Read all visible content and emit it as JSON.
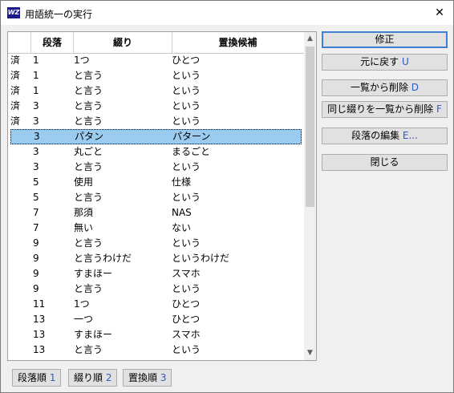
{
  "window": {
    "title": "用語統一の実行",
    "icon_label": "WZ",
    "close_glyph": "✕"
  },
  "list": {
    "headers": {
      "mark": "",
      "paragraph": "段落",
      "spelling": "綴り",
      "replacement": "置換候補"
    },
    "rows": [
      {
        "mark": "済",
        "para": "1",
        "spelling": "1つ",
        "replacement": "ひとつ",
        "selected": false
      },
      {
        "mark": "済",
        "para": "1",
        "spelling": "と言う",
        "replacement": "という",
        "selected": false
      },
      {
        "mark": "済",
        "para": "1",
        "spelling": "と言う",
        "replacement": "という",
        "selected": false
      },
      {
        "mark": "済",
        "para": "3",
        "spelling": "と言う",
        "replacement": "という",
        "selected": false
      },
      {
        "mark": "済",
        "para": "3",
        "spelling": "と言う",
        "replacement": "という",
        "selected": false
      },
      {
        "mark": "",
        "para": "3",
        "spelling": "パタン",
        "replacement": "パターン",
        "selected": true
      },
      {
        "mark": "",
        "para": "3",
        "spelling": "丸ごと",
        "replacement": "まるごと",
        "selected": false
      },
      {
        "mark": "",
        "para": "3",
        "spelling": "と言う",
        "replacement": "という",
        "selected": false
      },
      {
        "mark": "",
        "para": "5",
        "spelling": "使用",
        "replacement": "仕様",
        "selected": false
      },
      {
        "mark": "",
        "para": "5",
        "spelling": "と言う",
        "replacement": "という",
        "selected": false
      },
      {
        "mark": "",
        "para": "7",
        "spelling": "那須",
        "replacement": "NAS",
        "selected": false
      },
      {
        "mark": "",
        "para": "7",
        "spelling": "無い",
        "replacement": "ない",
        "selected": false
      },
      {
        "mark": "",
        "para": "9",
        "spelling": "と言う",
        "replacement": "という",
        "selected": false
      },
      {
        "mark": "",
        "para": "9",
        "spelling": "と言うわけだ",
        "replacement": "というわけだ",
        "selected": false
      },
      {
        "mark": "",
        "para": "9",
        "spelling": "すまほー",
        "replacement": "スマホ",
        "selected": false
      },
      {
        "mark": "",
        "para": "9",
        "spelling": "と言う",
        "replacement": "という",
        "selected": false
      },
      {
        "mark": "",
        "para": "11",
        "spelling": "1つ",
        "replacement": "ひとつ",
        "selected": false
      },
      {
        "mark": "",
        "para": "13",
        "spelling": "一つ",
        "replacement": "ひとつ",
        "selected": false
      },
      {
        "mark": "",
        "para": "13",
        "spelling": "すまほー",
        "replacement": "スマホ",
        "selected": false
      },
      {
        "mark": "",
        "para": "13",
        "spelling": "と言う",
        "replacement": "という",
        "selected": false
      }
    ]
  },
  "buttons": {
    "fix": {
      "label": "修正",
      "key": ""
    },
    "undo": {
      "label": "元に戻す",
      "key": "U"
    },
    "delete": {
      "label": "一覧から削除",
      "key": "D"
    },
    "delete_same": {
      "label": "同じ綴りを一覧から削除",
      "key": "F"
    },
    "edit_paragraph": {
      "label": "段落の編集",
      "key": "E..."
    },
    "close": {
      "label": "閉じる",
      "key": ""
    }
  },
  "sort_tabs": [
    {
      "label": "段落順",
      "key": "1"
    },
    {
      "label": "綴り順",
      "key": "2"
    },
    {
      "label": "置換順",
      "key": "3"
    }
  ],
  "scrollbar": {
    "up_glyph": "▲",
    "down_glyph": "▼"
  }
}
